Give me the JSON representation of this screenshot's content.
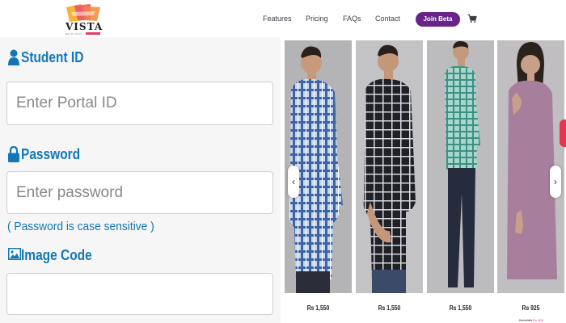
{
  "header": {
    "logo": {
      "name": "VISTA",
      "tagline": "WP PLUGIN"
    },
    "nav": [
      {
        "label": "Features"
      },
      {
        "label": "Pricing"
      },
      {
        "label": "FAQs"
      },
      {
        "label": "Contact"
      }
    ],
    "cta_label": "Join Beta",
    "cart_icon": "cart-icon"
  },
  "form": {
    "student_id": {
      "label": "Student ID",
      "placeholder": "Enter Portal ID",
      "icon": "user-icon"
    },
    "password": {
      "label": "Password",
      "placeholder": "Enter password",
      "icon": "lock-icon"
    },
    "password_hint": "( Password is case sensitive )",
    "image_code": {
      "label": "Image Code",
      "placeholder": "",
      "icon": "image-icon"
    },
    "accent_color": "#1477b5"
  },
  "carousel": {
    "products": [
      {
        "price": "Rs 1,550",
        "shirt": "blue checked shirt"
      },
      {
        "price": "Rs 1,550",
        "shirt": "black checked shirt"
      },
      {
        "price": "Rs 1,550",
        "shirt": "green checked shirt"
      },
      {
        "price": "Rs 925",
        "shirt": "mauve shirt"
      }
    ],
    "prev_icon": "chevron-left-icon",
    "next_icon": "chevron-right-icon",
    "strike": {
      "old": "Rs 1,325",
      "new": "Rs 925"
    }
  },
  "colors": {
    "cta": "#6a2389",
    "brand_accent": "#e53a64",
    "label": "#1477b5"
  }
}
